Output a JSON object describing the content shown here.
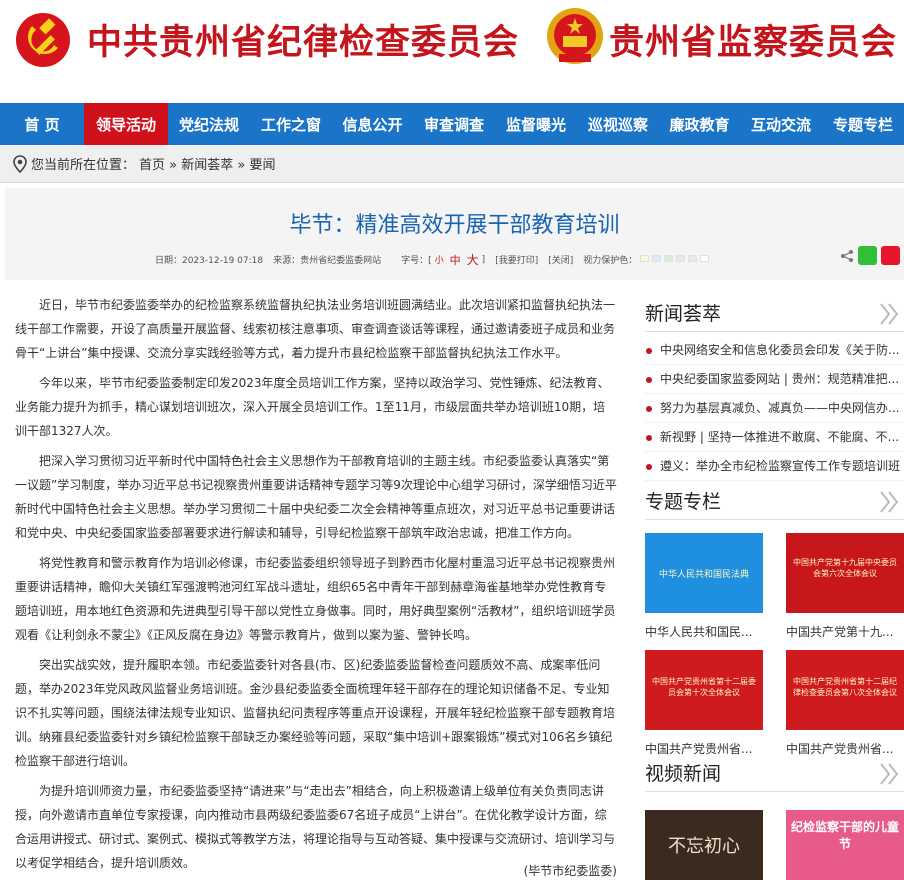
{
  "header": {
    "title_left": "中共贵州省纪律检查委员会",
    "title_right": "贵州省监察委员会",
    "party_emblem": "party-emblem",
    "state_emblem": "state-emblem"
  },
  "nav": {
    "items": [
      "首 页",
      "领导活动",
      "党纪法规",
      "工作之窗",
      "信息公开",
      "审查调查",
      "监督曝光",
      "巡视巡察",
      "廉政教育",
      "互动交流",
      "专题专栏"
    ],
    "active": "领导活动",
    "bar_color": "#1a74c8",
    "active_color": "#d0101a"
  },
  "breadcrumb": {
    "icon": "location-pin-icon",
    "label": "您当前所在位置：",
    "path": "首页 » 新闻荟萃 » 要闻"
  },
  "article": {
    "title": "毕节：精准高效开展干部教育培训",
    "meta": {
      "date": "日期：2023-12-19 07:18",
      "source": "来源：贵州省纪委监委网站",
      "font_size_label": "字号：[",
      "size_small": "小",
      "size_mid": "中",
      "size_big": "大",
      "size_close": "]",
      "print": "[我要打印]",
      "close": "[关闭]",
      "vision": "视力保护色："
    },
    "swatches": [
      "#fafad2",
      "#d9ecf7",
      "#dfe9d8",
      "#e8e8e8",
      "#f0e4ee",
      "#ffffff"
    ],
    "paragraphs": [
      "近日，毕节市纪委监委举办的纪检监察系统监督执纪执法业务培训班圆满结业。此次培训紧扣监督执纪执法一线干部工作需要，开设了高质量开展监督、线索初核注意事项、审查调查谈话等课程，通过邀请委班子成员和业务骨干“上讲台”集中授课、交流分享实践经验等方式，着力提升市县纪检监察干部监督执纪执法工作水平。",
      "今年以来，毕节市纪委监委制定印发2023年度全员培训工作方案，坚持以政治学习、党性锤炼、纪法教育、业务能力提升为抓手，精心谋划培训班次，深入开展全员培训工作。1至11月，市级层面共举办培训班10期，培训干部1327人次。",
      "把深入学习贯彻习近平新时代中国特色社会主义思想作为干部教育培训的主题主线。市纪委监委认真落实“第一议题”学习制度，举办习近平总书记视察贵州重要讲话精神专题学习等9次理论中心组学习研讨，深学细悟习近平新时代中国特色社会主义思想。举办学习贯彻二十届中央纪委二次全会精神等重点班次，对习近平总书记重要讲话和党中央、中央纪委国家监委部署要求进行解读和辅导，引导纪检监察干部筑牢政治忠诚，把准工作方向。",
      "将党性教育和警示教育作为培训必修课，市纪委监委组织领导班子到黔西市化屋村重温习近平总书记视察贵州重要讲话精神，瞻仰大关镇红军强渡鸭池河红军战斗遗址，组织65名中青年干部到赫章海雀基地举办党性教育专题培训班，用本地红色资源和先进典型引导干部以党性立身做事。同时，用好典型案例“活教材”，组织培训班学员观看《让利剑永不蒙尘》《正风反腐在身边》等警示教育片，做到以案为鉴、警钟长鸣。",
      "突出实战实效，提升履职本领。市纪委监委针对各县(市、区)纪委监委监督检查问题质效不高、成案率低问题，举办2023年党风政风监督业务培训班。金沙县纪委监委全面梳理年轻干部存在的理论知识储备不足、专业知识不扎实等问题，围绕法律法规专业知识、监督执纪问责程序等重点开设课程，开展年轻纪检监察干部专题教育培训。纳雍县纪委监委针对乡镇纪检监察干部缺乏办案经验等问题，采取“集中培训+跟案锻炼”模式对106名乡镇纪检监察干部进行培训。",
      "为提升培训师资力量，市纪委监委坚持“请进来”与“走出去”相结合，向上积极邀请上级单位有关负责同志讲授，向外邀请市直单位专家授课，向内推动市县两级纪委监委67名班子成员“上讲台”。在优化教学设计方面，综合运用讲授式、研讨式、案例式、模拟式等教学方法，将理论指导与互动答疑、集中授课与交流研讨、培训学习与以考促学相结合，提升培训质效。"
    ],
    "source_line": "(毕节市纪委监委)"
  },
  "sidebar": {
    "news": {
      "title": "新闻荟萃",
      "items": [
        "中央网络安全和信息化委员会印发《关于防...",
        "中央纪委国家监委网站 | 贵州：规范精准把...",
        "努力为基层真减负、减真负——中央网信办...",
        "新视野 | 坚持一体推进不敢腐、不能腐、不...",
        "遵义：举办全市纪检监察宣传工作专题培训班"
      ]
    },
    "topics": {
      "title": "专题专栏",
      "items": [
        {
          "caption": "中华人民共和国民...",
          "img_text": "中华人民共和国民法典",
          "color": "#1f8fe0"
        },
        {
          "caption": "中国共产党第十九...",
          "img_text": "中国共产党第十九届中央委员会第六次全体会议",
          "color": "#c8161d"
        },
        {
          "caption": "中国共产党贵州省...",
          "img_text": "中国共产党贵州省第十二届委员会第十次全体会议",
          "color": "#cf1a1f"
        },
        {
          "caption": "中国共产党贵州省...",
          "img_text": "中国共产党贵州省第十二届纪律检查委员会第八次全体会议",
          "color": "#cf1a1f"
        }
      ]
    },
    "video": {
      "title": "视频新闻",
      "items": [
        {
          "img_text": "不忘初心",
          "color": "#3a2a20"
        },
        {
          "img_text": "纪检监察干部的儿童节",
          "color": "#e85a8c"
        }
      ]
    }
  }
}
